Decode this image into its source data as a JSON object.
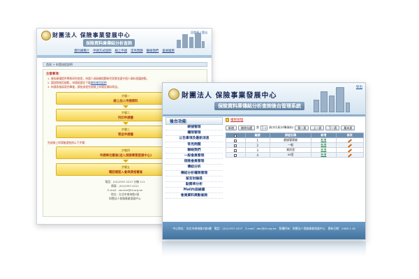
{
  "back_window": {
    "brand": "財團法人 保險事業發展中心",
    "subtitle": "保險資料庫傳結分析查詢",
    "top_link": "回首頁 | 登出",
    "nav": [
      "資料庫簡介",
      "申請方式說明",
      "線上申請",
      "常見問題",
      "聯絡我們",
      "會員服務"
    ],
    "tabbar": "首頁 > 申請流程說明",
    "notice_head": "注意事項：",
    "notice_lines": [
      "1. 資料庫僅提供學術研究使用，申請人須具備相關研究背景並遵守個人資料保護規範。",
      "2. 請詳閱使用規範，申請前請先下載",
      "3. 申請表格填寫完畢後，請依流程完成線上申請及資料寄送。"
    ],
    "notice_link": "資料使用說明",
    "steps": [
      {
        "num": "步驟一",
        "label": "線上加入申請資料"
      },
      {
        "num": "步驟二",
        "label": "列印申請書"
      },
      {
        "num": "步驟三",
        "label": "寄送申請書"
      },
      {
        "num": "步驟四",
        "label": "申請單位審查(送入保險事業發展中心)"
      },
      {
        "num": "步驟五",
        "label": "電話確認入會與資格審查"
      }
    ],
    "mid_note": "完成線上申請後請依照以下步驟：",
    "footer_lines": [
      "電話：(02)2397-2227 分機 111",
      "傳真：(02)2397-2221",
      "E-mail：service@tii.org.tw",
      "地址：台北市南海路3號",
      "財團法人保險事業發展中心"
    ]
  },
  "front_window": {
    "brand": "財團法人 保險事業發展中心",
    "subtitle": "保險資料庫傳結分析查詢後台管理系統",
    "logout": "登出",
    "sidebar_title": "後台功能",
    "sidebar_items": [
      "帳號管理",
      "權限管理",
      "公告事項及最新消息",
      "常見問題",
      "聯絡我們",
      "一般會員管理",
      "保險會員管理",
      "傳結分析",
      "傳結分析權限管理",
      "留言討論區",
      "點閱率分析",
      "Mail內容維護",
      "會員資料異動查詢"
    ],
    "main_title": "權限管理",
    "toolbar": {
      "add": "新增",
      "delete": "刪除勾選",
      "page_prefix": "第",
      "page_value": "1",
      "page_suffix": "頁(共1頁)(4筆資料)",
      "first": "第一頁",
      "prev": "上一頁",
      "next": "下一頁",
      "last": "最末頁"
    },
    "table": {
      "headers": [
        "",
        "編號",
        "群組名稱",
        "新增",
        "修改"
      ],
      "rows": [
        {
          "id": "1",
          "name": "超級管理者",
          "action": "新增"
        },
        {
          "id": "2",
          "name": "一般",
          "action": "新增"
        },
        {
          "id": "3",
          "name": "資訊室",
          "action": "新增"
        },
        {
          "id": "4",
          "name": "xx室",
          "action": "新增"
        }
      ]
    },
    "footer": "中心地址：台北市南海路3號8樓　電話：(02)2397-2227　E-mail：abc@tii.org.tw　版權所有：財團法人保險事業發展中心　更新日期：2008.1.18"
  },
  "colors": {
    "accent": "#1b3a78",
    "step_fill": "#f5d24a",
    "footer_bar": "#4f7fab",
    "table_header": "#6f8fb0"
  }
}
